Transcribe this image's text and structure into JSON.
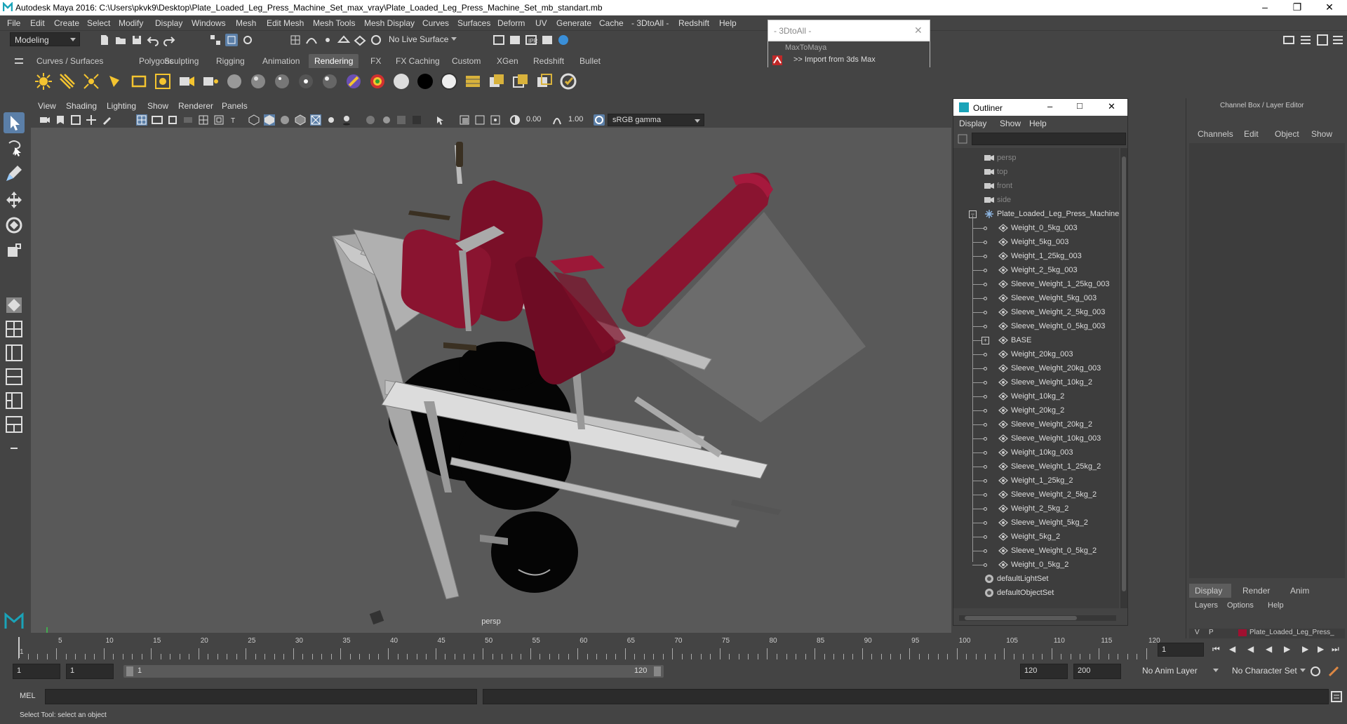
{
  "window": {
    "title": "Autodesk Maya 2016: C:\\Users\\pkvk9\\Desktop\\Plate_Loaded_Leg_Press_Machine_Set_max_vray\\Plate_Loaded_Leg_Press_Machine_Set_mb_standart.mb"
  },
  "menubar": [
    "File",
    "Edit",
    "Create",
    "Select",
    "Modify",
    "Display",
    "Windows",
    "Mesh",
    "Edit Mesh",
    "Mesh Tools",
    "Mesh Display",
    "Curves",
    "Surfaces",
    "Deform",
    "UV",
    "Generate",
    "Cache",
    "- 3DtoAll -",
    "Redshift",
    "Help"
  ],
  "status": {
    "mode": "Modeling",
    "live_surface": "No Live Surface"
  },
  "shelf_tabs": [
    "Curves / Surfaces",
    "Polygons",
    "Sculpting",
    "Rigging",
    "Animation",
    "Rendering",
    "FX",
    "FX Caching",
    "Custom",
    "XGen",
    "Redshift",
    "Bullet"
  ],
  "active_shelf": "Rendering",
  "popup": {
    "header": "- 3DtoAll -",
    "title": "MaxToMaya",
    "item": ">> Import from 3ds Max"
  },
  "viewport": {
    "menu": [
      "View",
      "Shading",
      "Lighting",
      "Show",
      "Renderer",
      "Panels"
    ],
    "exposure": "0.00",
    "gamma": "1.00",
    "colorspace": "sRGB gamma",
    "camera": "persp"
  },
  "outliner": {
    "title": "Outliner",
    "menu": [
      "Display",
      "Show",
      "Help"
    ],
    "cameras": [
      "persp",
      "top",
      "front",
      "side"
    ],
    "root": "Plate_Loaded_Leg_Press_Machine",
    "children": [
      "Weight_0_5kg_003",
      "Weight_5kg_003",
      "Weight_1_25kg_003",
      "Weight_2_5kg_003",
      "Sleeve_Weight_1_25kg_003",
      "Sleeve_Weight_5kg_003",
      "Sleeve_Weight_2_5kg_003",
      "Sleeve_Weight_0_5kg_003",
      "BASE",
      "Weight_20kg_003",
      "Sleeve_Weight_20kg_003",
      "Sleeve_Weight_10kg_2",
      "Weight_10kg_2",
      "Weight_20kg_2",
      "Sleeve_Weight_20kg_2",
      "Sleeve_Weight_10kg_003",
      "Weight_10kg_003",
      "Sleeve_Weight_1_25kg_2",
      "Weight_1_25kg_2",
      "Sleeve_Weight_2_5kg_2",
      "Weight_2_5kg_2",
      "Sleeve_Weight_5kg_2",
      "Weight_5kg_2",
      "Sleeve_Weight_0_5kg_2",
      "Weight_0_5kg_2"
    ],
    "sets": [
      "defaultLightSet",
      "defaultObjectSet"
    ]
  },
  "channelbox": {
    "title": "Channel Box / Layer Editor",
    "menu": [
      "Channels",
      "Edit",
      "Object",
      "Show"
    ],
    "tabs": [
      "Display",
      "Render",
      "Anim"
    ],
    "layer_menu": [
      "Layers",
      "Options",
      "Help"
    ],
    "layer": {
      "v": "V",
      "p": "P",
      "name": "Plate_Loaded_Leg_Press_",
      "color": "#a01030"
    }
  },
  "timeline": {
    "ticks": [
      "5",
      "10",
      "15",
      "20",
      "25",
      "30",
      "35",
      "40",
      "45",
      "50",
      "55",
      "60",
      "65",
      "70",
      "75",
      "80",
      "85",
      "90",
      "95",
      "100",
      "105",
      "110",
      "115",
      "120"
    ],
    "first": "1",
    "current": "1"
  },
  "range": {
    "start": "1",
    "start2": "1",
    "slider_start": "1",
    "slider_end": "120",
    "end": "120",
    "end2": "200",
    "anim_layer": "No Anim Layer",
    "char_set": "No Character Set"
  },
  "cmd": {
    "lang": "MEL"
  },
  "help": "Select Tool: select an object"
}
